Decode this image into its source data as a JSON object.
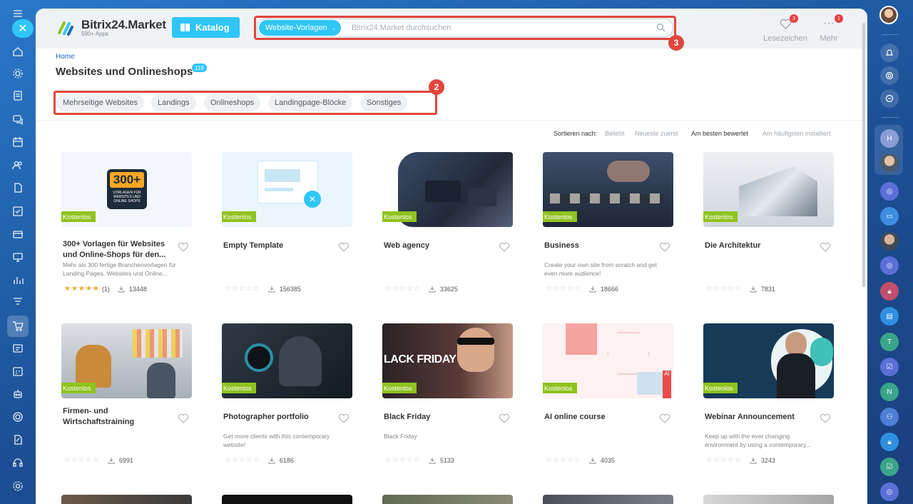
{
  "app": {
    "title": "Bitrix24.Market",
    "subtitle": "590+ Apps",
    "katalog_label": "Katalog"
  },
  "search": {
    "category": "Website-Vorlagen",
    "placeholder": "Bitrix24.Market durchsuchen"
  },
  "header_actions": {
    "bookmarks_label": "Lesezeichen",
    "bookmarks_count": "3",
    "more_label": "Mehr",
    "more_count": "1"
  },
  "annotations": {
    "filters_marker": "2",
    "search_marker": "3"
  },
  "breadcrumb": "Home",
  "page": {
    "title": "Websites und Onlineshops",
    "count": "119"
  },
  "filters": [
    "Mehrseitige Websites",
    "Landings",
    "Onlineshops",
    "Landingpage-Blöcke",
    "Sonstiges"
  ],
  "sort": {
    "label": "Sortieren nach:",
    "options": [
      "Beliebt",
      "Neueste zuerst",
      "Am besten bewertet",
      "Am häufigsten installiert"
    ],
    "active": "Am besten bewertet"
  },
  "free_label": "Kostenlos",
  "cards": [
    {
      "title": "300+ Vorlagen für Websites und Online-Shops für den...",
      "desc": "Mehr als 300 fertige Branchenvorlagen für Landing Pages, Websites und Online...",
      "rating": "(1)",
      "rated": true,
      "installs": "13448",
      "thumb_text": "300+",
      "thumb_sub": "VORLAGEN FÜR WEBSITES UND ONLINE SHOPS"
    },
    {
      "title": "Empty Template",
      "desc": "",
      "rating": "",
      "rated": false,
      "installs": "156385"
    },
    {
      "title": "Web agency",
      "desc": "",
      "rating": "",
      "rated": false,
      "installs": "33625"
    },
    {
      "title": "Business",
      "desc": "Create your own site from scratch and get even more audience!",
      "rating": "",
      "rated": false,
      "installs": "18666"
    },
    {
      "title": "Die Architektur",
      "desc": "",
      "rating": "",
      "rated": false,
      "installs": "7831"
    },
    {
      "title": "Firmen- und Wirtschaftstraining",
      "desc": "",
      "rating": "",
      "rated": false,
      "installs": "6991"
    },
    {
      "title": "Photographer portfolio",
      "desc": "Get more clients with this contemporary website!",
      "rating": "",
      "rated": false,
      "installs": "6186"
    },
    {
      "title": "Black Friday",
      "desc": "Black Friday",
      "rating": "",
      "rated": false,
      "installs": "5133",
      "thumb_text": "LACK FRIDAY"
    },
    {
      "title": "AI online course",
      "desc": "",
      "rating": "",
      "rated": false,
      "installs": "4035",
      "thumb_text": "AI"
    },
    {
      "title": "Webinar Announcement",
      "desc": "Keep up with the ever changing environment by using a contemporary...",
      "rating": "",
      "rated": false,
      "installs": "3243"
    }
  ],
  "right_rail": {
    "letters": [
      "H",
      "T",
      "N"
    ]
  },
  "colors": {
    "accent": "#2fc6f6",
    "highlight": "#e0463c",
    "free": "#8fc31f",
    "star": "#f5a623"
  }
}
